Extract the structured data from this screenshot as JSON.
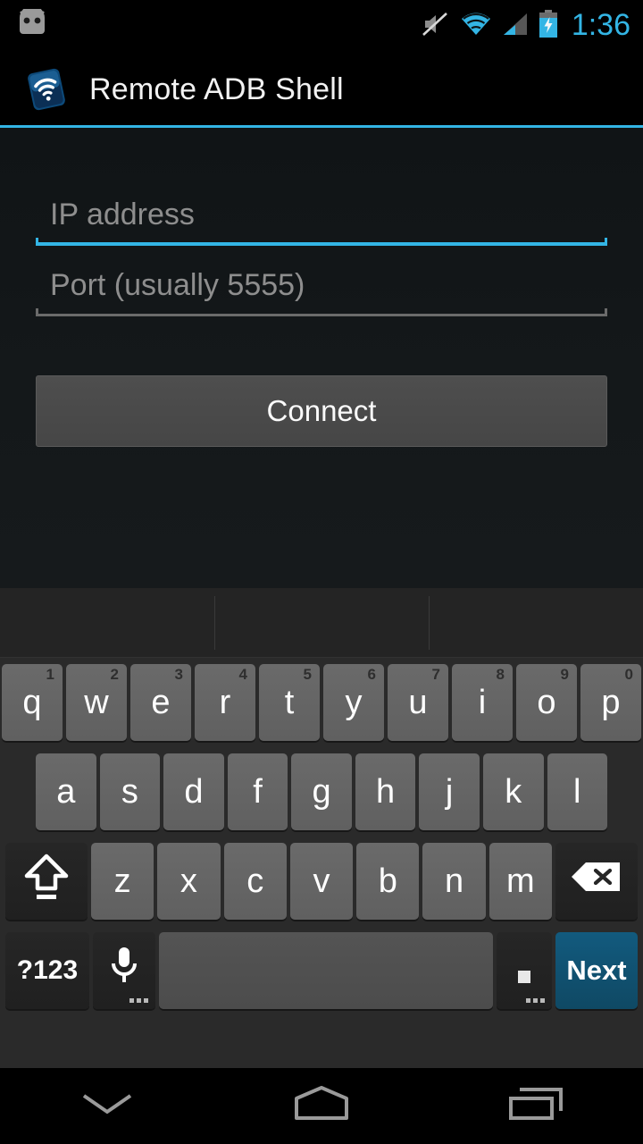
{
  "status_bar": {
    "time": "1:36",
    "accent_color": "#33b5e5",
    "icons": [
      {
        "name": "android-mascot-icon",
        "label": "Android"
      },
      {
        "name": "volume-muted-icon",
        "label": "Silent"
      },
      {
        "name": "wifi-icon",
        "label": "Wi-Fi"
      },
      {
        "name": "cell-signal-icon",
        "label": "Signal"
      },
      {
        "name": "battery-charging-icon",
        "label": "Charging"
      }
    ]
  },
  "action_bar": {
    "title": "Remote ADB Shell",
    "icon_name": "app-wifi-tablet-icon",
    "divider_color": "#33b5e5"
  },
  "form": {
    "ip_field": {
      "placeholder": "IP address",
      "value": "",
      "focused": true,
      "underline_color": "#33b5e5"
    },
    "port_field": {
      "placeholder": "Port (usually 5555)",
      "value": "",
      "focused": false,
      "underline_color": "#6b6b6b"
    },
    "connect_button": {
      "label": "Connect"
    }
  },
  "keyboard": {
    "suggestions": [
      "",
      "",
      ""
    ],
    "row1": [
      {
        "key": "q",
        "sup": "1"
      },
      {
        "key": "w",
        "sup": "2"
      },
      {
        "key": "e",
        "sup": "3"
      },
      {
        "key": "r",
        "sup": "4"
      },
      {
        "key": "t",
        "sup": "5"
      },
      {
        "key": "y",
        "sup": "6"
      },
      {
        "key": "u",
        "sup": "7"
      },
      {
        "key": "i",
        "sup": "8"
      },
      {
        "key": "o",
        "sup": "9"
      },
      {
        "key": "p",
        "sup": "0"
      }
    ],
    "row2": [
      {
        "key": "a"
      },
      {
        "key": "s"
      },
      {
        "key": "d"
      },
      {
        "key": "f"
      },
      {
        "key": "g"
      },
      {
        "key": "h"
      },
      {
        "key": "j"
      },
      {
        "key": "k"
      },
      {
        "key": "l"
      }
    ],
    "row3": [
      {
        "key": "z"
      },
      {
        "key": "x"
      },
      {
        "key": "c"
      },
      {
        "key": "v"
      },
      {
        "key": "b"
      },
      {
        "key": "n"
      },
      {
        "key": "m"
      }
    ],
    "shift_key": {
      "name": "shift-key",
      "label": ""
    },
    "backspace_key": {
      "name": "backspace-key",
      "label": ""
    },
    "symbols_key": {
      "label": "?123"
    },
    "mic_key": {
      "name": "microphone-key",
      "label": ""
    },
    "space_key": {
      "name": "space-key",
      "label": ""
    },
    "period_key": {
      "name": "period-key",
      "label": "."
    },
    "action_key": {
      "label": "Next",
      "color": "#125a7e"
    }
  },
  "nav_bar": {
    "back_icon": "keyboard-hide-chevron-icon",
    "home_icon": "home-icon",
    "recents_icon": "recent-apps-icon"
  }
}
